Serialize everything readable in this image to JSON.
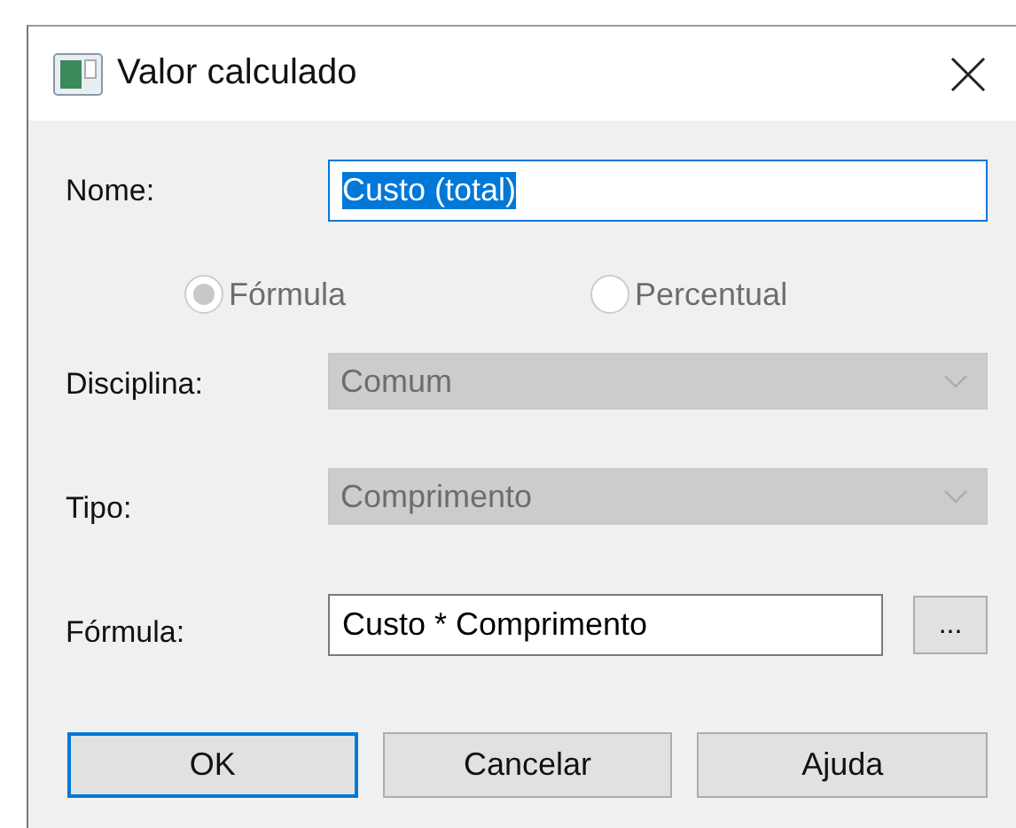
{
  "window": {
    "title": "Valor calculado"
  },
  "name": {
    "label": "Nome:",
    "value": "Custo (total)",
    "text_selected": true
  },
  "mode": {
    "disabled": true,
    "options": [
      {
        "label": "Fórmula",
        "selected": true
      },
      {
        "label": "Percentual",
        "selected": false
      }
    ]
  },
  "combos": [
    {
      "label": "Disciplina:",
      "value": "Comum",
      "disabled": true
    },
    {
      "label": "Tipo:",
      "value": "Comprimento",
      "disabled": true
    }
  ],
  "formula": {
    "label": "Fórmula:",
    "value": "Custo * Comprimento",
    "browse_button": "..."
  },
  "buttons": [
    {
      "label": "OK",
      "default": true
    },
    {
      "label": "Cancelar",
      "default": false
    },
    {
      "label": "Ajuda",
      "default": false
    }
  ]
}
